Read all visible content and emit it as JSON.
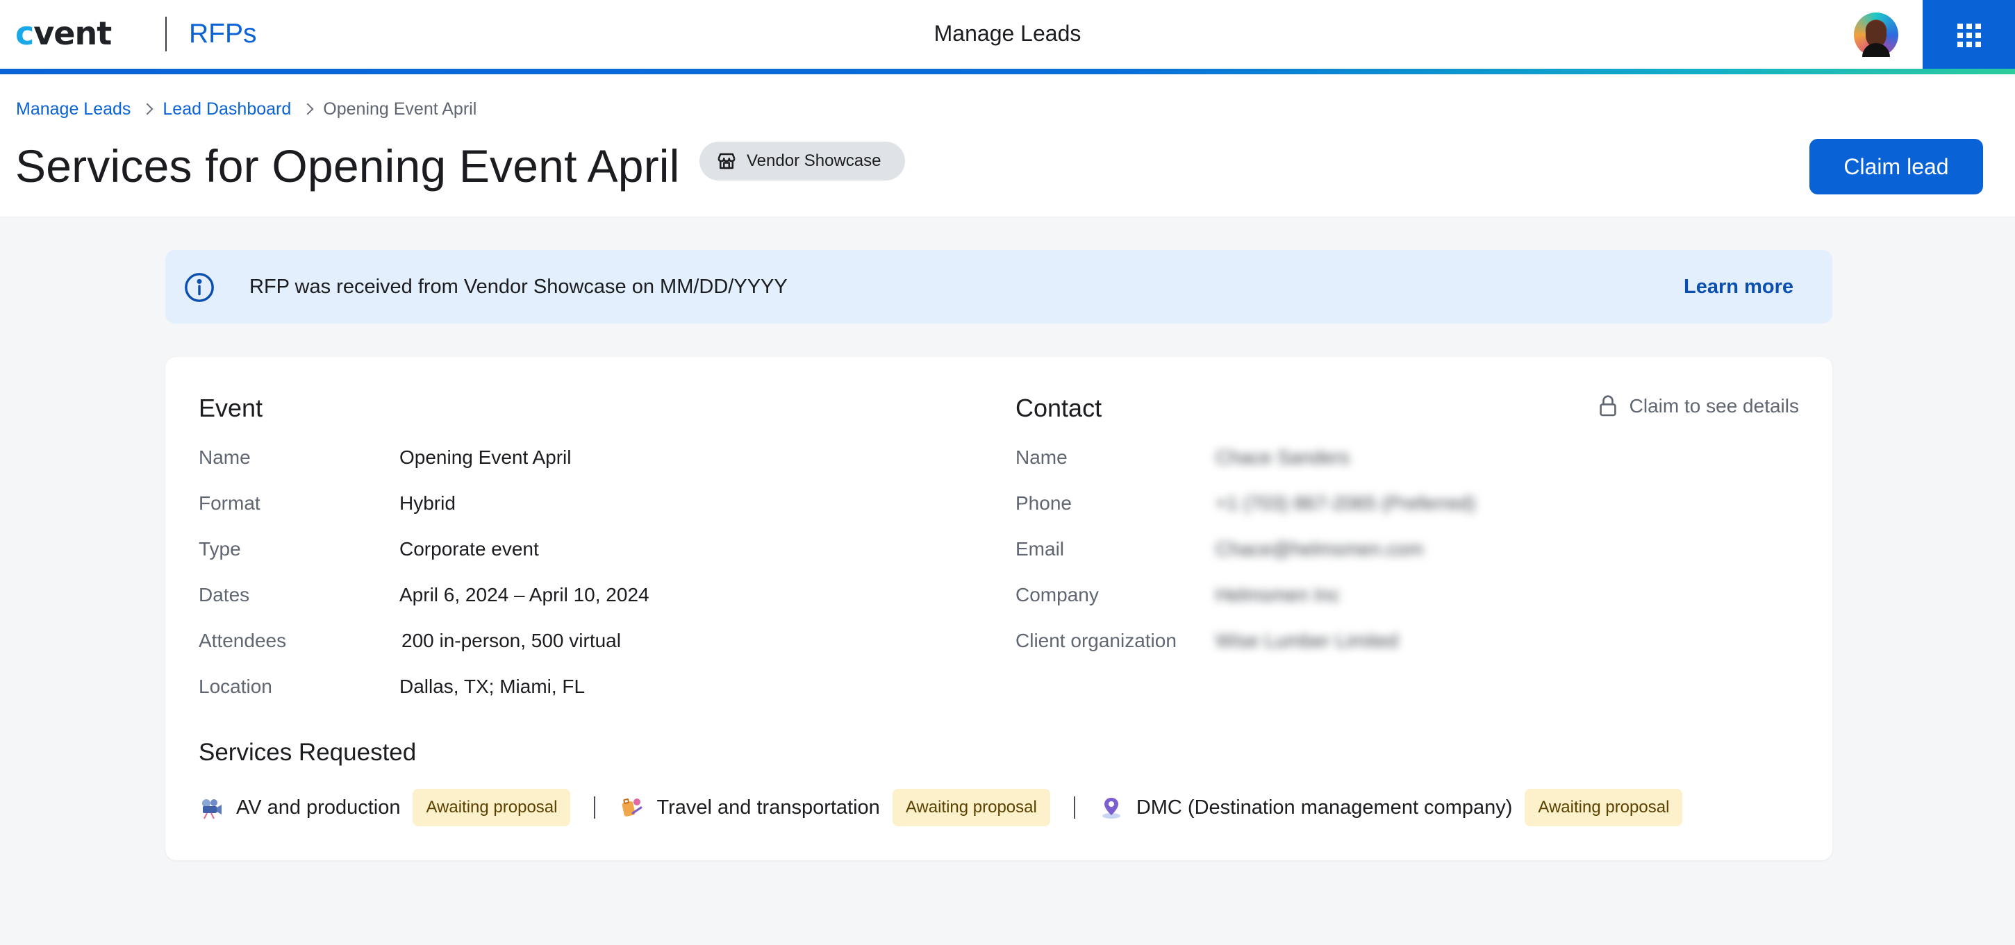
{
  "topbar": {
    "logo_text": "cvent",
    "app_name": "RFPs",
    "title": "Manage Leads",
    "avatar_icon": "user-avatar",
    "apps_icon": "grid-menu-icon",
    "accent_color": "#0a63d6"
  },
  "breadcrumb": {
    "items": [
      {
        "label": "Manage Leads"
      },
      {
        "label": "Lead Dashboard"
      },
      {
        "label": "Opening Event April"
      }
    ]
  },
  "header": {
    "title": "Services for Opening Event April",
    "source_chip": "Vendor Showcase",
    "claim_button": "Claim lead"
  },
  "banner": {
    "message": "RFP was received from Vendor Showcase on MM/DD/YYYY",
    "link": "Learn more"
  },
  "event": {
    "title": "Event",
    "rows": [
      {
        "label": "Name",
        "value": "Opening Event April"
      },
      {
        "label": "Format",
        "value": "Hybrid"
      },
      {
        "label": "Type",
        "value": "Corporate event"
      },
      {
        "label": "Dates",
        "value": "April 6, 2024 – April 10, 2024"
      },
      {
        "label": "Attendees",
        "value": "200 in-person, 500 virtual"
      },
      {
        "label": "Location",
        "value": "Dallas, TX; Miami, FL"
      }
    ]
  },
  "contact": {
    "title": "Contact",
    "claim_hint": "Claim to see details",
    "rows": [
      {
        "label": "Name",
        "value": "Chace Sanders"
      },
      {
        "label": "Phone",
        "value": "+1 (703) 867-2065 (Preferred)"
      },
      {
        "label": "Email",
        "value": "Chace@helmsmen.com"
      },
      {
        "label": "Company",
        "value": "Helmsmen Inc"
      },
      {
        "label": "Client organization",
        "value": "Wise Lumber Limited"
      }
    ]
  },
  "services": {
    "title": "Services Requested",
    "items": [
      {
        "label": "AV and production",
        "status": "Awaiting proposal",
        "icon": "camera-icon"
      },
      {
        "label": "Travel and transportation",
        "status": "Awaiting proposal",
        "icon": "travel-icon"
      },
      {
        "label": "DMC (Destination management company)",
        "status": "Awaiting proposal",
        "icon": "map-pin-icon"
      }
    ]
  }
}
